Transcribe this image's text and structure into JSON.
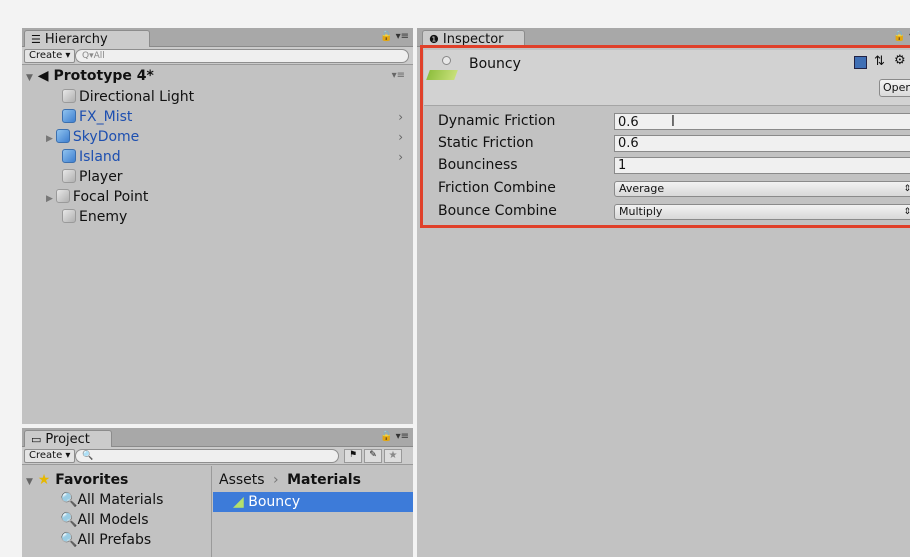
{
  "hierarchy": {
    "tab_label": "Hierarchy",
    "create_label": "Create",
    "search_placeholder": "Q▾All",
    "scene_name": "Prototype 4*",
    "items": [
      {
        "label": "Directional Light"
      },
      {
        "label": "FX_Mist"
      },
      {
        "label": "SkyDome"
      },
      {
        "label": "Island"
      },
      {
        "label": "Player"
      },
      {
        "label": "Focal Point"
      },
      {
        "label": "Enemy"
      }
    ]
  },
  "project": {
    "tab_label": "Project",
    "create_label": "Create",
    "favorites_label": "Favorites",
    "favorites": [
      {
        "label": "All Materials"
      },
      {
        "label": "All Models"
      },
      {
        "label": "All Prefabs"
      }
    ],
    "breadcrumb": {
      "root": "Assets",
      "sep": "›",
      "current": "Materials"
    },
    "assets": [
      {
        "label": "Bouncy"
      }
    ]
  },
  "inspector": {
    "tab_label": "Inspector",
    "asset_name": "Bouncy",
    "open_label": "Open",
    "fields": [
      {
        "label": "Dynamic Friction",
        "value": "0.6"
      },
      {
        "label": "Static Friction",
        "value": "0.6"
      },
      {
        "label": "Bounciness",
        "value": "1"
      }
    ],
    "dropdowns": [
      {
        "label": "Friction Combine",
        "value": "Average"
      },
      {
        "label": "Bounce Combine",
        "value": "Multiply"
      }
    ]
  },
  "colors": {
    "highlight_border": "#e0402a",
    "selection_blue": "#3d7bd9",
    "scene_item_blue": "#1d4fb0"
  }
}
